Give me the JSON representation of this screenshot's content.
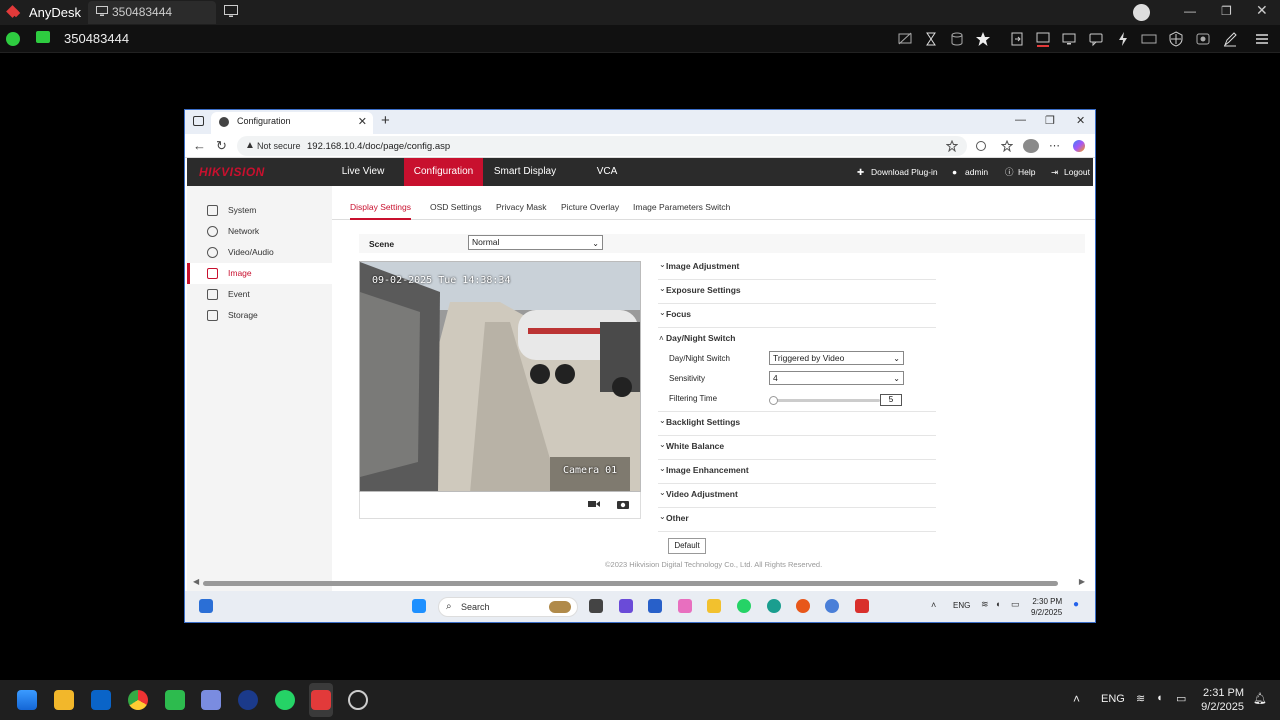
{
  "anydesk": {
    "app_name": "AnyDesk",
    "tab_label": "350483444",
    "session_id": "350483444"
  },
  "browser": {
    "tab_title": "Configuration",
    "not_secure": "Not secure",
    "url": "192.168.10.4/doc/page/config.asp"
  },
  "hikvision": {
    "logo": "HIKVISION",
    "nav": [
      "Live View",
      "Configuration",
      "Smart Display",
      "VCA"
    ],
    "right": {
      "download": "Download Plug-in",
      "user": "admin",
      "help": "Help",
      "logout": "Logout"
    },
    "sidebar": [
      "System",
      "Network",
      "Video/Audio",
      "Image",
      "Event",
      "Storage"
    ],
    "subtabs": [
      "Display Settings",
      "OSD Settings",
      "Privacy Mask",
      "Picture Overlay",
      "Image Parameters Switch"
    ],
    "scene_label": "Scene",
    "scene_value": "Normal",
    "video": {
      "timestamp": "09-02-2025 Tue 14:38:34",
      "camera_label": "Camera 01"
    },
    "sections": [
      "Image Adjustment",
      "Exposure Settings",
      "Focus",
      "Day/Night Switch",
      "Backlight Settings",
      "White Balance",
      "Image Enhancement",
      "Video Adjustment",
      "Other"
    ],
    "daynight": {
      "switch_label": "Day/Night Switch",
      "switch_value": "Triggered by Video",
      "sensitivity_label": "Sensitivity",
      "sensitivity_value": "4",
      "filtering_label": "Filtering Time",
      "filtering_value": "5"
    },
    "default_button": "Default",
    "footer": "©2023 Hikvision Digital Technology Co., Ltd. All Rights Reserved."
  },
  "remote_taskbar": {
    "search": "Search",
    "lang": "ENG",
    "time": "2:30 PM",
    "date": "9/2/2025"
  },
  "local_taskbar": {
    "lang": "ENG",
    "time": "2:31 PM",
    "date": "9/2/2025"
  },
  "colors": {
    "accent": "#c8102e",
    "header": "#2b2b2b",
    "anydesk_green": "#2ecc40"
  }
}
